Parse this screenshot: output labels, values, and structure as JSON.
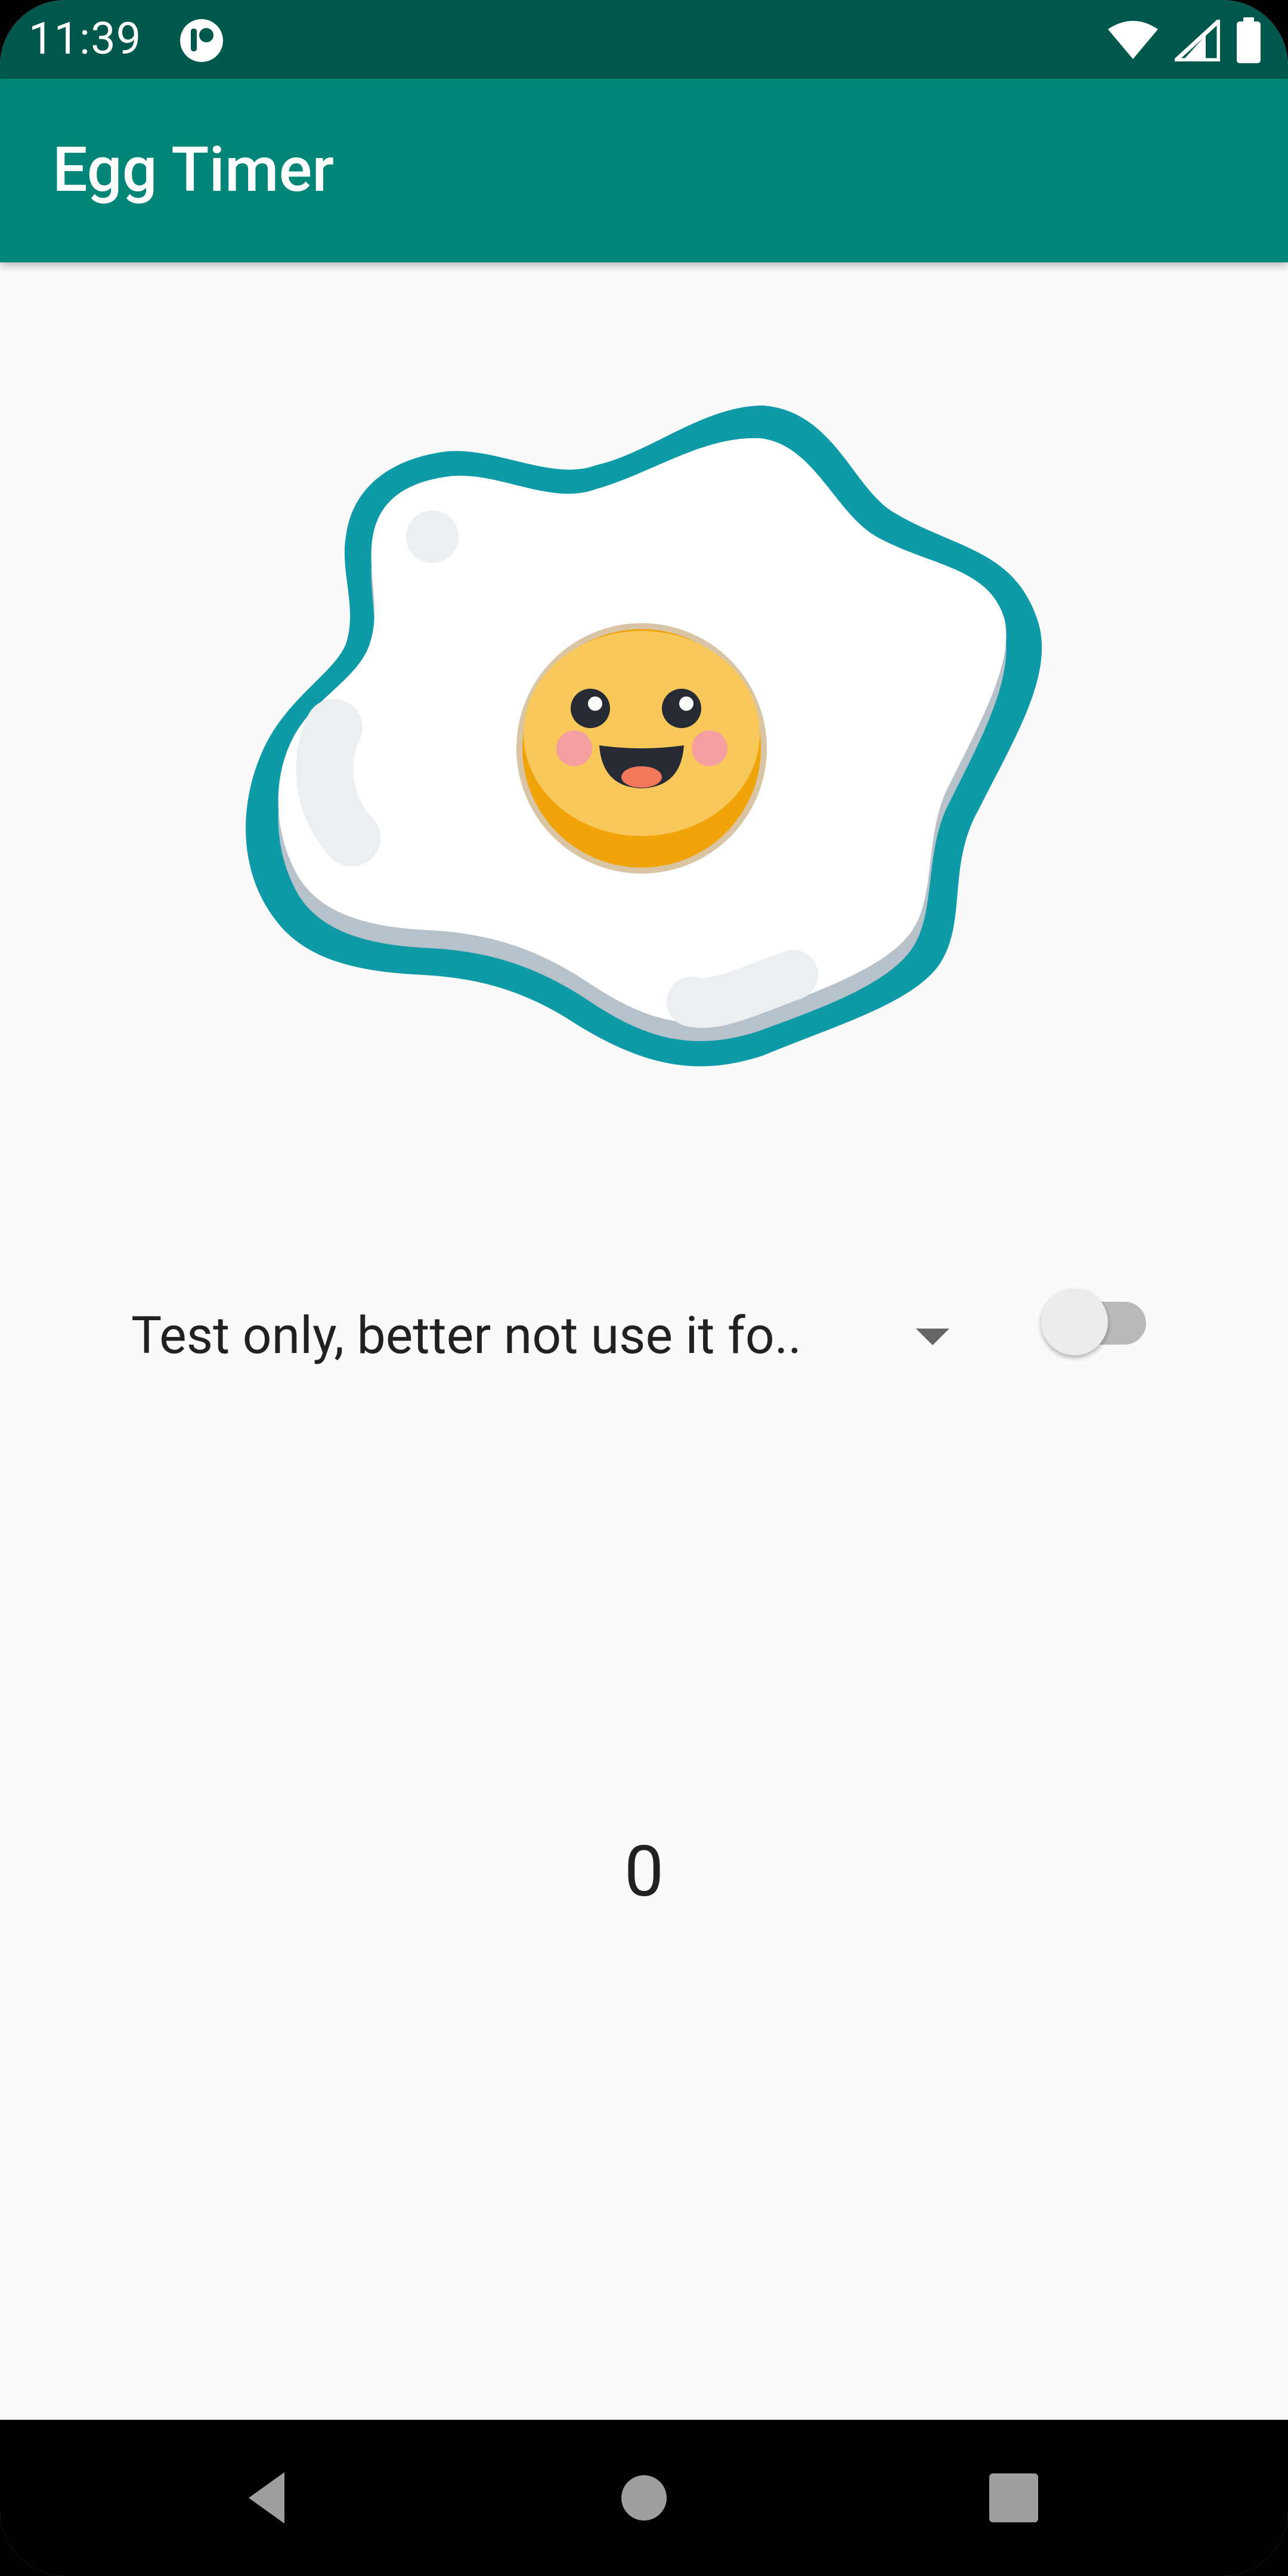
{
  "status_bar": {
    "time": "11:39",
    "icons": [
      "app-notification-icon",
      "wifi-icon",
      "cellular-signal-icon",
      "battery-icon"
    ]
  },
  "app_bar": {
    "title": "Egg Timer"
  },
  "illustration": {
    "name": "fried-egg-illustration"
  },
  "controls": {
    "spinner_selected": "Test only, better not use it fo..",
    "switch_on": false
  },
  "timer": {
    "value": "0"
  },
  "nav_bar": {
    "buttons": [
      "back",
      "home",
      "recents"
    ]
  },
  "colors": {
    "status_bar": "#00574b",
    "app_bar": "#008577",
    "background": "#fafafa",
    "egg_outline": "#0e9aa7",
    "yolk": "#f9c85b"
  }
}
